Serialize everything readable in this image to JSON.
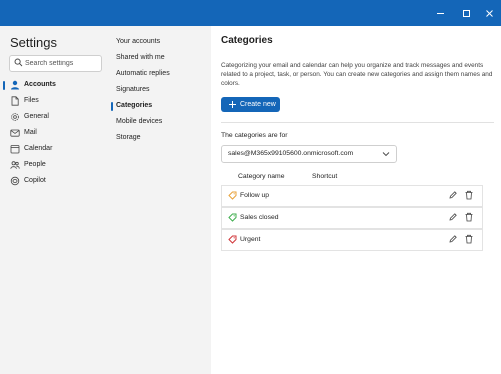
{
  "window": {
    "minimize_icon": "minimize-icon",
    "maximize_icon": "maximize-icon",
    "close_icon": "close-icon",
    "titlebar_color": "#1466b8"
  },
  "sidebar": {
    "title": "Settings",
    "search_placeholder": "Search settings",
    "items": [
      {
        "label": "Accounts",
        "icon": "person-icon",
        "active": true
      },
      {
        "label": "Files",
        "icon": "file-icon"
      },
      {
        "label": "General",
        "icon": "gear-icon"
      },
      {
        "label": "Mail",
        "icon": "mail-icon"
      },
      {
        "label": "Calendar",
        "icon": "calendar-icon"
      },
      {
        "label": "People",
        "icon": "people-icon"
      },
      {
        "label": "Copilot",
        "icon": "copilot-icon"
      }
    ]
  },
  "subnav": {
    "items": [
      {
        "label": "Your accounts"
      },
      {
        "label": "Shared with me"
      },
      {
        "label": "Automatic replies"
      },
      {
        "label": "Signatures"
      },
      {
        "label": "Categories",
        "active": true
      },
      {
        "label": "Mobile devices"
      },
      {
        "label": "Storage"
      }
    ]
  },
  "main": {
    "title": "Categories",
    "description": "Categorizing your email and calendar can help you organize and track messages and events related to a project, task, or person. You can create new categories and assign them names and colors.",
    "create_button": "Create new",
    "for_label": "The categories are for",
    "account": "sales@M365x99105600.onmicrosoft.com",
    "col_name": "Category name",
    "col_shortcut": "Shortcut",
    "categories": [
      {
        "name": "Follow up",
        "color": "#e8a23a"
      },
      {
        "name": "Sales closed",
        "color": "#3fae4e"
      },
      {
        "name": "Urgent",
        "color": "#d13438"
      }
    ]
  }
}
